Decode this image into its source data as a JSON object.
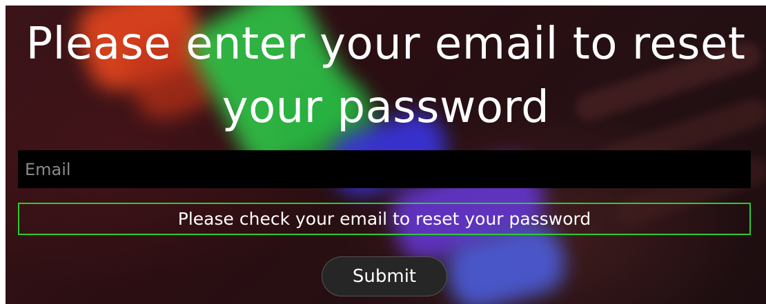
{
  "form": {
    "title": "Please enter your email to reset your password",
    "email_placeholder": "Email",
    "email_value": "",
    "message": "Please check your email to reset your password",
    "submit_label": "Submit"
  },
  "colors": {
    "message_border": "#2ecc2e",
    "input_background": "#000000",
    "button_background": "#262626",
    "text": "#ffffff"
  }
}
